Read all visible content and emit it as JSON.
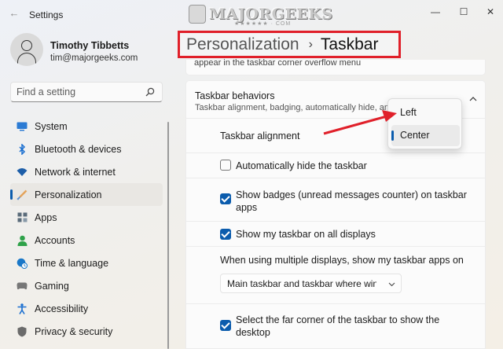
{
  "window": {
    "title": "Settings"
  },
  "watermark": {
    "text": "MAJORGEEKS",
    "stars": "★★★★★★ · COM"
  },
  "user": {
    "name": "Timothy Tibbetts",
    "email": "tim@majorgeeks.com"
  },
  "search": {
    "placeholder": "Find a setting"
  },
  "nav": {
    "items": [
      {
        "label": "System",
        "icon": "monitor-icon",
        "color": "#2b7bd4"
      },
      {
        "label": "Bluetooth & devices",
        "icon": "bluetooth-icon",
        "color": "#1a6fd0"
      },
      {
        "label": "Network & internet",
        "icon": "wifi-icon",
        "color": "#1d5ea8"
      },
      {
        "label": "Personalization",
        "icon": "brush-icon",
        "color": "#c77a3a",
        "active": true
      },
      {
        "label": "Apps",
        "icon": "apps-icon",
        "color": "#5a6b7a"
      },
      {
        "label": "Accounts",
        "icon": "person-icon",
        "color": "#2fa24a"
      },
      {
        "label": "Time & language",
        "icon": "globe-clock-icon",
        "color": "#1a78c8"
      },
      {
        "label": "Gaming",
        "icon": "gamepad-icon",
        "color": "#777777"
      },
      {
        "label": "Accessibility",
        "icon": "accessibility-icon",
        "color": "#1a6fd0"
      },
      {
        "label": "Privacy & security",
        "icon": "shield-icon",
        "color": "#6b6b6b"
      }
    ]
  },
  "breadcrumb": {
    "parent": "Personalization",
    "separator": "›",
    "current": "Taskbar"
  },
  "content": {
    "cut_text": "appear in the taskbar corner overflow menu",
    "behaviors": {
      "title": "Taskbar behaviors",
      "subtitle": "Taskbar alignment, badging, automatically hide, and"
    },
    "alignment_label": "Taskbar alignment",
    "auto_hide": {
      "label": "Automatically hide the taskbar",
      "checked": false
    },
    "badges": {
      "label_line1": "Show badges (unread messages counter) on taskbar",
      "label_line2": "apps",
      "checked": true
    },
    "all_displays": {
      "label": "Show my taskbar on all displays",
      "checked": true
    },
    "multi_display": {
      "label": "When using multiple displays, show my taskbar apps on",
      "value": "Main taskbar and taskbar where window is open"
    },
    "far_corner": {
      "label_line1": "Select the far corner of the taskbar to show the",
      "label_line2": "desktop",
      "checked": true
    }
  },
  "flyout": {
    "options": [
      "Left",
      "Center"
    ],
    "selected": "Center"
  },
  "colors": {
    "accent": "#0b5cad",
    "highlight": "#e0202a"
  }
}
